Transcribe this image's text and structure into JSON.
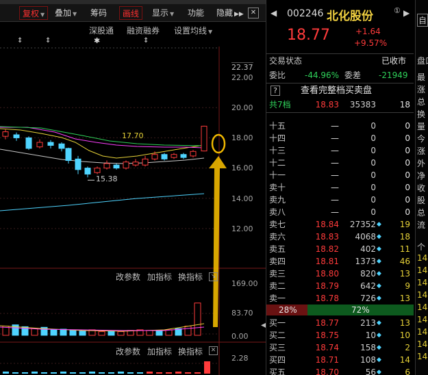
{
  "toolbar": {
    "items": [
      {
        "label": "复权",
        "has_arrow": true,
        "selected": true
      },
      {
        "label": "叠加",
        "has_arrow": true
      },
      {
        "label": "筹码"
      },
      {
        "label": "画线",
        "selected": true
      },
      {
        "label": "显示",
        "has_arrow": true
      },
      {
        "label": "功能"
      },
      {
        "label": "隐藏"
      }
    ]
  },
  "subbar": {
    "items": [
      "深股通",
      "融资融券",
      "设置均线"
    ]
  },
  "chart": {
    "price_axis": [
      "22.37",
      "22.00",
      "20.00",
      "18.00",
      "16.00",
      "14.00",
      "12.00"
    ],
    "annot_high": "17.70",
    "annot_low": "15.38",
    "volume_axis": [
      "169.00",
      "83.70",
      "0.00"
    ],
    "macd_axis": [
      "2.28"
    ],
    "panel_buttons": [
      "改参数",
      "加指标",
      "换指标"
    ]
  },
  "quote": {
    "code": "002246",
    "name": "北化股份",
    "badge": "①",
    "price": "18.77",
    "change": "+1.64",
    "change_pct": "+9.57%",
    "status_label": "交易状态",
    "status_value": "已收市",
    "weibi_label": "委比",
    "weibi_value": "-44.96%",
    "weicha_label": "委差",
    "weicha_value": "-21949",
    "full_depth_label": "查看完整档买卖盘",
    "depth_levels": "共7档",
    "depth_price": "18.83",
    "depth_vol": "35383",
    "depth_cnt": "18",
    "sell_rows": [
      {
        "name": "十五",
        "price": "—",
        "vol": "0",
        "cnt": "0"
      },
      {
        "name": "十四",
        "price": "—",
        "vol": "0",
        "cnt": "0"
      },
      {
        "name": "十三",
        "price": "—",
        "vol": "0",
        "cnt": "0"
      },
      {
        "name": "十二",
        "price": "—",
        "vol": "0",
        "cnt": "0"
      },
      {
        "name": "十一",
        "price": "—",
        "vol": "0",
        "cnt": "0"
      },
      {
        "name": "卖十",
        "price": "—",
        "vol": "0",
        "cnt": "0"
      },
      {
        "name": "卖九",
        "price": "—",
        "vol": "0",
        "cnt": "0"
      },
      {
        "name": "卖八",
        "price": "—",
        "vol": "0",
        "cnt": "0"
      },
      {
        "name": "卖七",
        "price": "18.84",
        "vol": "27352",
        "cnt": "19"
      },
      {
        "name": "卖六",
        "price": "18.83",
        "vol": "4068",
        "cnt": "18"
      },
      {
        "name": "卖五",
        "price": "18.82",
        "vol": "402",
        "cnt": "11"
      },
      {
        "name": "卖四",
        "price": "18.81",
        "vol": "1373",
        "cnt": "46"
      },
      {
        "name": "卖三",
        "price": "18.80",
        "vol": "820",
        "cnt": "13"
      },
      {
        "name": "卖二",
        "price": "18.79",
        "vol": "642",
        "cnt": "9"
      },
      {
        "name": "卖一",
        "price": "18.78",
        "vol": "726",
        "cnt": "13"
      }
    ],
    "ratio_sell": "28%",
    "ratio_buy": "72%",
    "ratio_sell_fraction": 0.28,
    "buy_rows": [
      {
        "name": "买一",
        "price": "18.77",
        "vol": "213",
        "cnt": "13"
      },
      {
        "name": "买二",
        "price": "18.75",
        "vol": "10",
        "cnt": "10"
      },
      {
        "name": "买三",
        "price": "18.74",
        "vol": "158",
        "cnt": "2"
      },
      {
        "name": "买四",
        "price": "18.71",
        "vol": "108",
        "cnt": "14"
      },
      {
        "name": "买五",
        "price": "18.70",
        "vol": "56",
        "cnt": "6"
      }
    ]
  },
  "sidecol": {
    "top": [
      "自"
    ],
    "mid": [
      "盘口"
    ],
    "items": [
      "最",
      "涨",
      "总",
      "换",
      "量",
      "今",
      "涨",
      "外",
      "净",
      "收",
      "股",
      "总",
      "流"
    ],
    "lower": [
      "个",
      "14",
      "14",
      "14",
      "14",
      "14",
      "14",
      "14",
      "14",
      "14"
    ]
  },
  "colors": {
    "up": "#ff3b3b",
    "down": "#2fd25a",
    "ma": "#e8d338",
    "cyan": "#4fd4ff"
  }
}
